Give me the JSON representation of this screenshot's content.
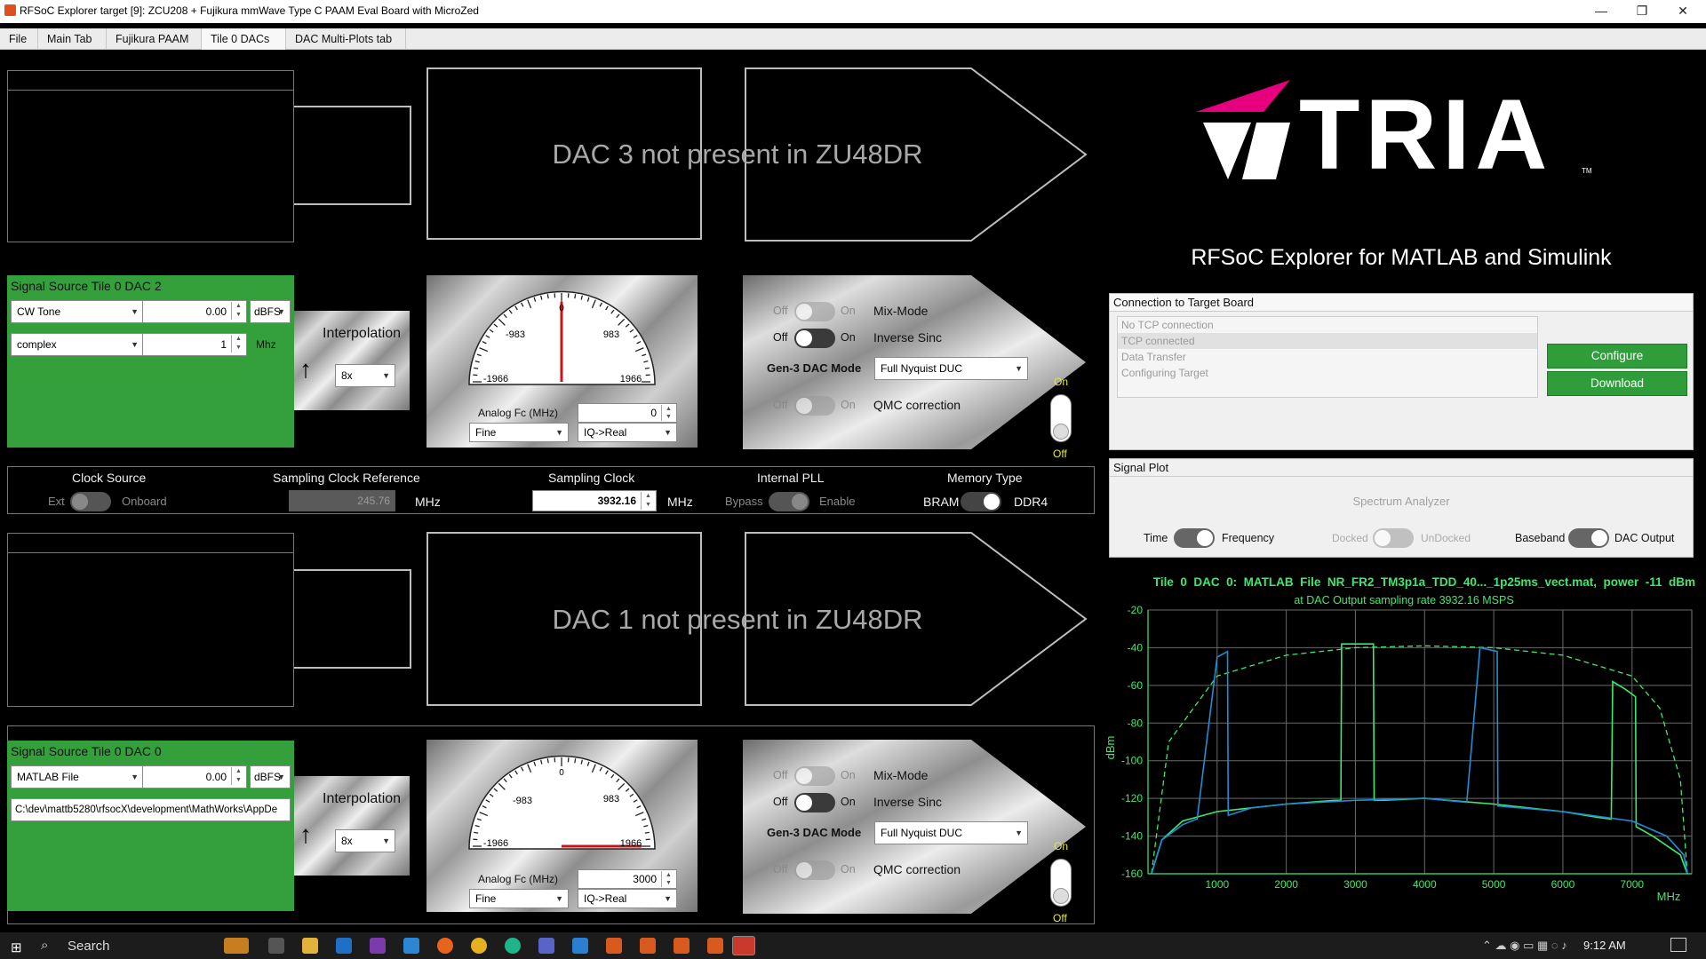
{
  "window": {
    "title": "RFSoC Explorer target [9]: ZCU208 + Fujikura mmWave Type C PAAM Eval Board with MicroZed",
    "controls": [
      "—",
      "❐",
      "✕"
    ]
  },
  "tabs": [
    "File",
    "Main Tab",
    "Fujikura PAAM",
    "Tile 0 DACs",
    "DAC Multi-Plots tab"
  ],
  "dac3": {
    "absent_text": "DAC 3 not present in ZU48DR"
  },
  "dac1": {
    "absent_text": "DAC 1 not present in ZU48DR"
  },
  "dac2": {
    "source_title": "Signal Source Tile 0 DAC 2",
    "waveform": "CW Tone",
    "power": "0.00",
    "power_unit": "dBFS",
    "mode": "complex",
    "freq": "1",
    "freq_unit": "Mhz",
    "interpolation_label": "Interpolation",
    "interpolation": "8x",
    "dial": {
      "min": "-1966",
      "max": "1966",
      "left": "-983",
      "right": "983",
      "center": "0",
      "value": 0
    },
    "analog_fc_label": "Analog Fc (MHz)",
    "analog_fc": "0",
    "nco": "Fine",
    "iq": "IQ->Real",
    "mix_off": "Off",
    "mix_on": "On",
    "mix_label": "Mix-Mode",
    "sinc_off": "Off",
    "sinc_on": "On",
    "sinc_label": "Inverse Sinc",
    "gen3_label": "Gen-3 DAC Mode",
    "gen3_value": "Full Nyquist DUC",
    "qmc_off": "Off",
    "qmc_on": "On",
    "qmc_label": "QMC correction",
    "enable_on": "On",
    "enable_off": "Off"
  },
  "dac0": {
    "source_title": "Signal Source Tile 0 DAC 0",
    "waveform": "MATLAB File",
    "power": "0.00",
    "power_unit": "dBFS",
    "path": "C:\\dev\\mattb5280\\rfsocX\\development\\MathWorks\\AppDe",
    "interpolation_label": "Interpolation",
    "interpolation": "8x",
    "dial": {
      "min": "-1966",
      "max": "1966",
      "left": "-983",
      "right": "983",
      "center": "0",
      "value": 3000
    },
    "analog_fc_label": "Analog Fc (MHz)",
    "analog_fc": "3000",
    "nco": "Fine",
    "iq": "IQ->Real",
    "mix_off": "Off",
    "mix_on": "On",
    "mix_label": "Mix-Mode",
    "sinc_off": "Off",
    "sinc_on": "On",
    "sinc_label": "Inverse Sinc",
    "gen3_label": "Gen-3 DAC Mode",
    "gen3_value": "Full Nyquist DUC",
    "qmc_off": "Off",
    "qmc_on": "On",
    "qmc_label": "QMC correction",
    "enable_on": "On",
    "enable_off": "Off"
  },
  "clock_bar": {
    "clock_source_label": "Clock Source",
    "ext": "Ext",
    "onboard": "Onboard",
    "ref_label": "Sampling Clock Reference",
    "ref_value": "245.76",
    "ref_unit": "MHz",
    "clock_label": "Sampling Clock",
    "clock_value": "3932.16",
    "clock_unit": "MHz",
    "pll_label": "Internal PLL",
    "bypass": "Bypass",
    "enable": "Enable",
    "mem_label": "Memory Type",
    "bram": "BRAM",
    "ddr4": "DDR4"
  },
  "brand": {
    "logo_text": "TRIA",
    "tm": "TM",
    "subtitle": "RFSoC Explorer for MATLAB and Simulink",
    "accent": "#e6007e"
  },
  "connection": {
    "title": "Connection to Target Board",
    "status": [
      "No TCP connection",
      "TCP connected",
      "Data Transfer",
      "Configuring Target"
    ],
    "configure": "Configure",
    "download": "Download"
  },
  "signal_plot": {
    "title": "Signal Plot",
    "analyzer": "Spectrum Analyzer",
    "time": "Time",
    "frequency": "Frequency",
    "docked": "Docked",
    "undocked": "UnDocked",
    "baseband": "Baseband",
    "dac_output": "DAC Output"
  },
  "chart_data": {
    "type": "line",
    "title": "Tile  0  DAC  0:  MATLAB  File  NR_FR2_TM3p1a_TDD_40..._1p25ms_vect.mat,  power  -11  dBm",
    "subtitle": "at DAC Output sampling rate 3932.16 MSPS",
    "xlabel": "MHz",
    "ylabel": "dBm",
    "xlim": [
      0,
      7864
    ],
    "ylim": [
      -160,
      -20
    ],
    "xticks": [
      1000,
      2000,
      3000,
      4000,
      5000,
      6000,
      7000
    ],
    "yticks": [
      -20,
      -40,
      -60,
      -80,
      -100,
      -120,
      -140,
      -160
    ],
    "grid": true,
    "colors": {
      "green": "#3ee86b",
      "blue": "#1e8fd6"
    },
    "series": [
      {
        "color": "green",
        "style": "dashed",
        "x": [
          50,
          300,
          1000,
          2000,
          3000,
          4000,
          5000,
          6000,
          7000,
          7400,
          7700,
          7800
        ],
        "y": [
          -160,
          -90,
          -55,
          -44,
          -40,
          -39,
          -40,
          -44,
          -55,
          -72,
          -110,
          -160
        ]
      },
      {
        "color": "green",
        "style": "solid",
        "x": [
          50,
          200,
          500,
          1000,
          2000,
          2700,
          2790,
          2800,
          3000,
          3150,
          3260,
          3270,
          3400,
          4000,
          5000,
          6000,
          6500,
          6700,
          6720,
          6900,
          7050,
          7060,
          7300,
          7700,
          7800
        ],
        "y": [
          -160,
          -142,
          -132,
          -127,
          -123,
          -121,
          -121,
          -38,
          -38,
          -38,
          -38,
          -121,
          -121,
          -120,
          -123,
          -127,
          -130,
          -131,
          -58,
          -62,
          -66,
          -135,
          -140,
          -150,
          -160
        ]
      },
      {
        "color": "blue",
        "style": "solid",
        "x": [
          50,
          200,
          500,
          700,
          710,
          1000,
          1150,
          1160,
          1500,
          2000,
          3000,
          4000,
          4600,
          4610,
          4800,
          5050,
          5060,
          6000,
          7000,
          7500,
          7750,
          7800
        ],
        "y": [
          -160,
          -142,
          -134,
          -131,
          -131,
          -45,
          -42,
          -129,
          -125,
          -123,
          -121,
          -120,
          -122,
          -122,
          -40,
          -42,
          -124,
          -127,
          -132,
          -140,
          -150,
          -160
        ]
      }
    ]
  },
  "taskbar": {
    "search": "Search",
    "time": "9:12 AM"
  }
}
